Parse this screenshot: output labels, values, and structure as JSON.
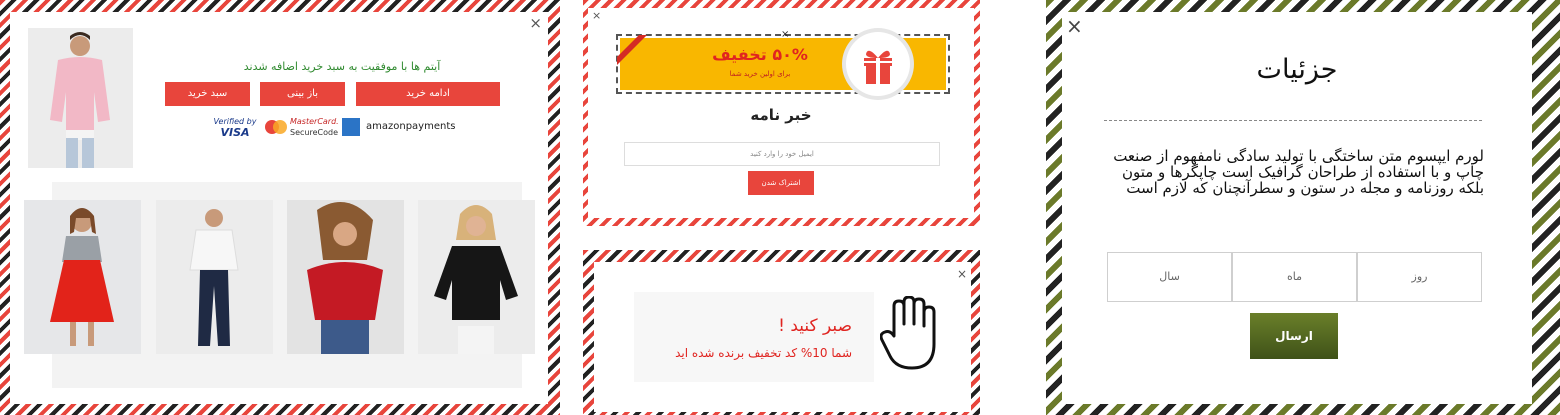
{
  "cart_popup": {
    "close": "×",
    "message": "آیتم ها با موفقیت به سبد خرید اضافه شدند",
    "buttons": {
      "continue": "ادامه خرید",
      "review": "باز بینی",
      "cart": "سبد خرید"
    },
    "payments": {
      "verified_line1": "Verified by",
      "verified_line2": "VISA",
      "mastercard_line1": "MasterCard.",
      "mastercard_line2": "SecureCode",
      "amazon": "amazonpayments"
    }
  },
  "newsletter_popup": {
    "close": "×",
    "banner_close": "×",
    "discount_title": "۵۰% تخفیف",
    "discount_subtitle": "برای اولین خرید شما",
    "title": "خبر نامه",
    "email_placeholder": "ایمیل خود را وارد کنید",
    "subscribe": "اشتراک شدن"
  },
  "wait_popup": {
    "close": "×",
    "title": "صبر کنید !",
    "message": "شما 10% کد تخفیف برنده شده اید"
  },
  "details_popup": {
    "close": "×",
    "title": "جزئیات",
    "body": "لورم ایپسوم متن ساختگی با تولید سادگی نامفهوم از صنعت چاپ و با استفاده از طراحان گرافیک است چاپگرها و متون بلکه روزنامه و مجله در ستون و سطرآنچنان که لازم است",
    "fields": {
      "day": "روز",
      "month": "ماه",
      "year": "سال"
    },
    "submit": "ارسال"
  },
  "colors": {
    "accent_red": "#e8453c",
    "banner_yellow": "#f9b700",
    "success_green": "#2f8a2f",
    "olive": "#4c5e1e"
  }
}
